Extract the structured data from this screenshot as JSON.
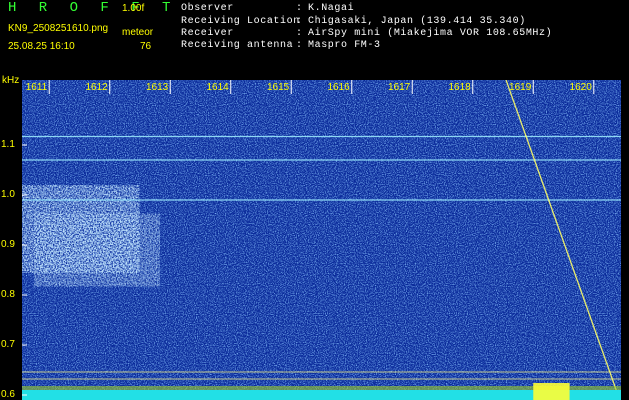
{
  "header": {
    "app_title": "H R O F F T",
    "version": "1.00f",
    "filename": "KN9_2508251610.png",
    "datetime": "25.08.25 16:10",
    "meteor_label": "meteor",
    "meteor_count": "76",
    "info": [
      {
        "label": "Observer",
        "sep": ":",
        "value": "K.Nagai"
      },
      {
        "label": "Receiving Location",
        "sep": ":",
        "value": "Chigasaki, Japan (139.414 35.340)"
      },
      {
        "label": "Receiver",
        "sep": ":",
        "value": "AirSpy mini (Miakejima VOR 108.65MHz)"
      },
      {
        "label": "Receiving antenna",
        "sep": ":",
        "value": "Maspro FM-3"
      }
    ]
  },
  "colors": {
    "background": "#000000",
    "title": "#33ff33",
    "label": "#ffff00",
    "info_text": "#ffffff",
    "spectrogram_base": "#0a2a9a",
    "carrier_line": "#9ff0ff",
    "meteor_trace": "#ffff66",
    "bottom_band": "#22e0e6"
  },
  "chart_data": {
    "type": "heatmap",
    "xlabel": "",
    "ylabel": "kHz",
    "x_ticks": [
      "1611",
      "1612",
      "1613",
      "1614",
      "1615",
      "1616",
      "1617",
      "1618",
      "1619",
      "1620"
    ],
    "x_range": [
      1610.55,
      1620.45
    ],
    "y_ticks": [
      "1.1",
      "1.0",
      "0.9",
      "0.8",
      "0.7",
      "0.6"
    ],
    "y_range": [
      0.59,
      1.23
    ],
    "grid": false,
    "horizontal_lines_khz": [
      1.117,
      1.07,
      0.99
    ],
    "diagonal_trace": {
      "x": [
        1618.55,
        1620.4
      ],
      "y_khz": [
        1.23,
        0.6
      ]
    },
    "meteor_echo_cloud": {
      "x": [
        1610.6,
        1612.4
      ],
      "y_khz": [
        0.88,
        1.0
      ]
    },
    "bottom_bright_region": {
      "x": [
        1619.0,
        1619.6
      ]
    }
  }
}
